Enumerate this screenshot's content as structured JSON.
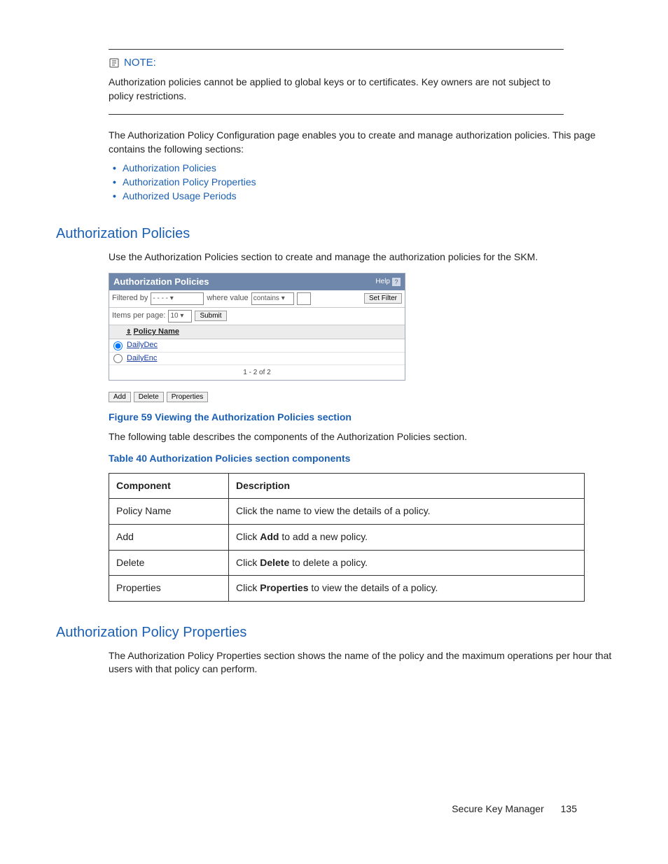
{
  "note": {
    "label": "NOTE:",
    "body": "Authorization policies cannot be applied to global keys or to certificates. Key owners are not subject to policy restrictions."
  },
  "intro": "The Authorization Policy Configuration page enables you to create and manage authorization policies. This page contains the following sections:",
  "links": [
    "Authorization Policies",
    "Authorization Policy Properties",
    "Authorized Usage Periods"
  ],
  "section1": {
    "heading": "Authorization Policies",
    "body": "Use the Authorization Policies section to create and manage the authorization policies for the SKM.",
    "figure_caption": "Figure 59 Viewing the Authorization Policies section",
    "after_figure": "The following table describes the components of the Authorization Policies section.",
    "table_caption": "Table 40 Authorization Policies section components"
  },
  "ui": {
    "title": "Authorization Policies",
    "help": "Help",
    "filtered_by": "Filtered by",
    "select_blank": "- - - -",
    "where_value": "where value",
    "contains": "contains",
    "set_filter": "Set Filter",
    "items_per_page": "Items per page:",
    "ipp_value": "10",
    "submit": "Submit",
    "col_head": "Policy Name",
    "rows": [
      {
        "name": "DailyDec",
        "selected": true
      },
      {
        "name": "DailyEnc",
        "selected": false
      }
    ],
    "range": "1 - 2 of 2",
    "actions": {
      "add": "Add",
      "delete": "Delete",
      "properties": "Properties"
    }
  },
  "table": {
    "headers": {
      "c1": "Component",
      "c2": "Description"
    },
    "rows": [
      {
        "name": "Policy Name",
        "desc_pre": "Click the name to view the details of a policy.",
        "bold": "",
        "desc_post": ""
      },
      {
        "name": "Add",
        "desc_pre": "Click ",
        "bold": "Add",
        "desc_post": " to add a new policy."
      },
      {
        "name": "Delete",
        "desc_pre": "Click ",
        "bold": "Delete",
        "desc_post": " to delete a policy."
      },
      {
        "name": "Properties",
        "desc_pre": "Click ",
        "bold": "Properties",
        "desc_post": " to view the details of a policy."
      }
    ]
  },
  "section2": {
    "heading": "Authorization Policy Properties",
    "body": "The Authorization Policy Properties section shows the name of the policy and the maximum operations per hour that users with that policy can perform."
  },
  "footer": {
    "book": "Secure Key Manager",
    "page": "135"
  }
}
